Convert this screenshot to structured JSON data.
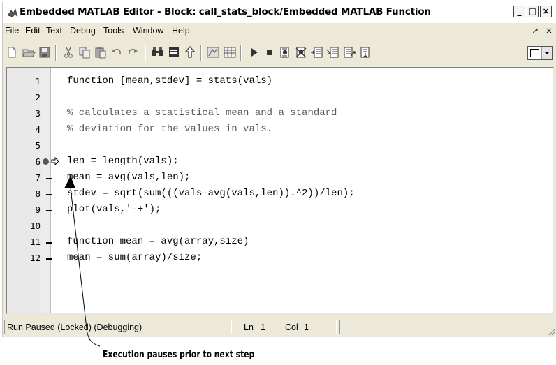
{
  "window": {
    "title": "Embedded MATLAB Editor - Block: call_stats_block/Embedded MATLAB Function",
    "controls": {
      "minimize": "_",
      "maximize": "□",
      "close": "×"
    }
  },
  "menubar": {
    "items": [
      "File",
      "Edit",
      "Text",
      "Debug",
      "Tools",
      "Window",
      "Help"
    ],
    "undock": "↗",
    "close": "×"
  },
  "toolbar": {
    "icons": [
      "new-file-icon",
      "open-file-icon",
      "save-icon",
      "cut-icon",
      "copy-icon",
      "paste-icon",
      "undo-icon",
      "redo-icon",
      "find-icon",
      "go-to-line-icon",
      "go-to-function-icon",
      "build-icon",
      "ports-data-icon",
      "run-icon",
      "stop-icon",
      "set-clear-breakpoint-icon",
      "clear-all-breakpoints-icon",
      "step-icon",
      "step-in-icon",
      "step-out-icon",
      "continue-icon"
    ]
  },
  "editor": {
    "lines": [
      {
        "n": "1",
        "text": "function [mean,stdev] = stats(vals)",
        "comment": false,
        "executable": false
      },
      {
        "n": "2",
        "text": "",
        "comment": false,
        "executable": false
      },
      {
        "n": "3",
        "text": "% calculates a statistical mean and a standard",
        "comment": true,
        "executable": false
      },
      {
        "n": "4",
        "text": "% deviation for the values in vals.",
        "comment": true,
        "executable": false
      },
      {
        "n": "5",
        "text": "",
        "comment": false,
        "executable": false
      },
      {
        "n": "6",
        "text": "len = length(vals);",
        "comment": false,
        "executable": false,
        "breakpoint": true,
        "current": true
      },
      {
        "n": "7",
        "text": "mean = avg(vals,len);",
        "comment": false,
        "executable": true
      },
      {
        "n": "8",
        "text": "stdev = sqrt(sum(((vals-avg(vals,len)).^2))/len);",
        "comment": false,
        "executable": true
      },
      {
        "n": "9",
        "text": "plot(vals,'-+');",
        "comment": false,
        "executable": true
      },
      {
        "n": "10",
        "text": "",
        "comment": false,
        "executable": false
      },
      {
        "n": "11",
        "text": "function mean = avg(array,size)",
        "comment": false,
        "executable": true
      },
      {
        "n": "12",
        "text": "mean = sum(array)/size;",
        "comment": false,
        "executable": true
      }
    ]
  },
  "statusbar": {
    "status": "Run Paused (Locked) (Debugging)",
    "ln_label": "Ln",
    "ln_value": "1",
    "col_label": "Col",
    "col_value": "1"
  },
  "annotation": {
    "text": "Execution pauses prior to next step"
  },
  "colors": {
    "chrome": "#ece9d8",
    "gutter": "#e9e9e9",
    "comment": "#5a5a5a",
    "breakpoint": "#555555"
  }
}
